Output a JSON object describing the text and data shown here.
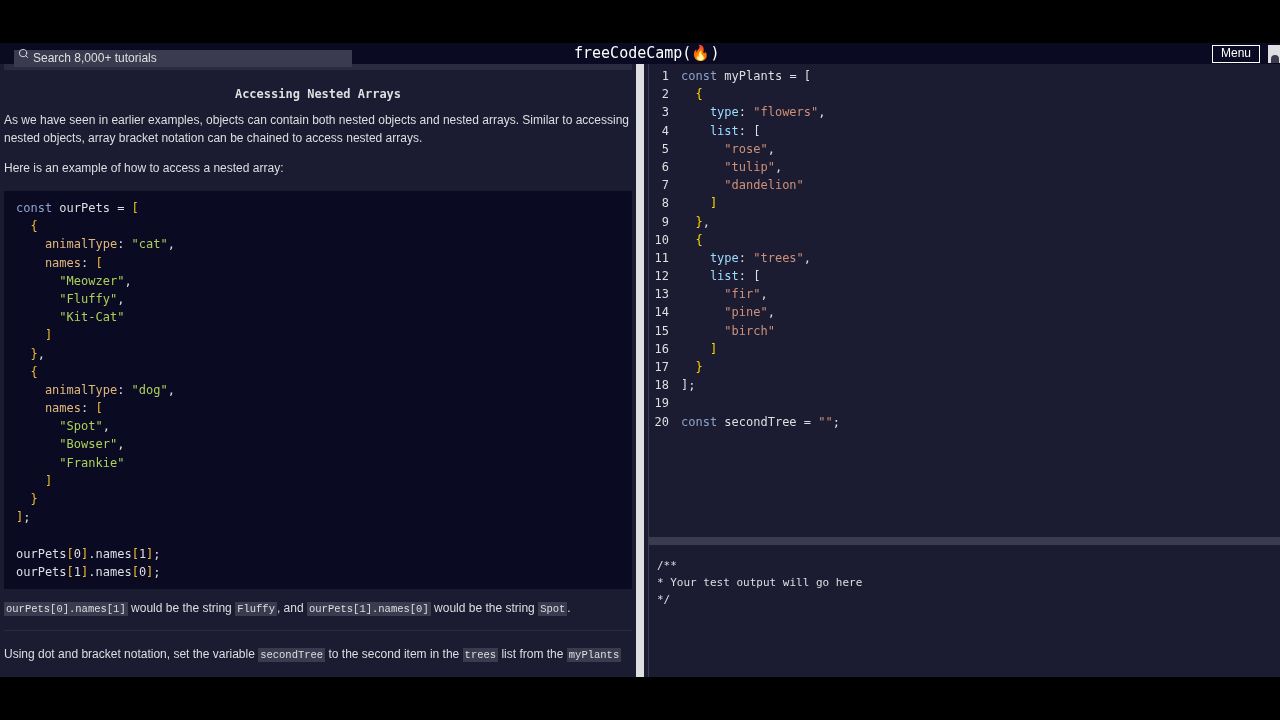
{
  "nav": {
    "search_placeholder": "Search 8,000+ tutorials",
    "logo": "freeCodeCamp(🔥)",
    "menu_button": "Menu"
  },
  "lesson": {
    "title": "Accessing Nested Arrays",
    "paragraphs": [
      [
        {
          "kind": "text",
          "t": "As we have seen in earlier examples, objects can contain both nested objects and nested arrays. Similar to accessing nested objects, array bracket notation can be chained to access nested arrays."
        }
      ],
      [
        {
          "kind": "text",
          "t": "Here is an example of how to access a nested array:"
        }
      ]
    ],
    "example_code": [
      {
        "kind": "code",
        "tokens": [
          {
            "kind": "kw",
            "t": "const"
          },
          {
            "kind": "id",
            "t": " ourPets "
          },
          {
            "kind": "op",
            "t": "= "
          },
          {
            "kind": "br",
            "t": "["
          }
        ]
      },
      {
        "kind": "code",
        "tokens": [
          {
            "kind": "br",
            "t": "  {"
          }
        ]
      },
      {
        "kind": "code",
        "tokens": [
          {
            "kind": "prop",
            "t": "    animalType"
          },
          {
            "kind": "op",
            "t": ": "
          },
          {
            "kind": "str",
            "t": "\"cat\""
          },
          {
            "kind": "op",
            "t": ","
          }
        ]
      },
      {
        "kind": "code",
        "tokens": [
          {
            "kind": "prop",
            "t": "    names"
          },
          {
            "kind": "op",
            "t": ": "
          },
          {
            "kind": "br",
            "t": "["
          }
        ]
      },
      {
        "kind": "code",
        "tokens": [
          {
            "kind": "str",
            "t": "      \"Meowzer\""
          },
          {
            "kind": "op",
            "t": ","
          }
        ]
      },
      {
        "kind": "code",
        "tokens": [
          {
            "kind": "str",
            "t": "      \"Fluffy\""
          },
          {
            "kind": "op",
            "t": ","
          }
        ]
      },
      {
        "kind": "code",
        "tokens": [
          {
            "kind": "str",
            "t": "      \"Kit-Cat\""
          }
        ]
      },
      {
        "kind": "code",
        "tokens": [
          {
            "kind": "br",
            "t": "    ]"
          }
        ]
      },
      {
        "kind": "code",
        "tokens": [
          {
            "kind": "br",
            "t": "  }"
          },
          {
            "kind": "op",
            "t": ","
          }
        ]
      },
      {
        "kind": "code",
        "tokens": [
          {
            "kind": "br",
            "t": "  {"
          }
        ]
      },
      {
        "kind": "code",
        "tokens": [
          {
            "kind": "prop",
            "t": "    animalType"
          },
          {
            "kind": "op",
            "t": ": "
          },
          {
            "kind": "str",
            "t": "\"dog\""
          },
          {
            "kind": "op",
            "t": ","
          }
        ]
      },
      {
        "kind": "code",
        "tokens": [
          {
            "kind": "prop",
            "t": "    names"
          },
          {
            "kind": "op",
            "t": ": "
          },
          {
            "kind": "br",
            "t": "["
          }
        ]
      },
      {
        "kind": "code",
        "tokens": [
          {
            "kind": "str",
            "t": "      \"Spot\""
          },
          {
            "kind": "op",
            "t": ","
          }
        ]
      },
      {
        "kind": "code",
        "tokens": [
          {
            "kind": "str",
            "t": "      \"Bowser\""
          },
          {
            "kind": "op",
            "t": ","
          }
        ]
      },
      {
        "kind": "code",
        "tokens": [
          {
            "kind": "str",
            "t": "      \"Frankie\""
          }
        ]
      },
      {
        "kind": "code",
        "tokens": [
          {
            "kind": "br",
            "t": "    ]"
          }
        ]
      },
      {
        "kind": "code",
        "tokens": [
          {
            "kind": "br",
            "t": "  }"
          }
        ]
      },
      {
        "kind": "code",
        "tokens": [
          {
            "kind": "br",
            "t": "]"
          },
          {
            "kind": "op",
            "t": ";"
          }
        ]
      },
      {
        "kind": "blank"
      },
      {
        "kind": "code",
        "tokens": [
          {
            "kind": "id",
            "t": "ourPets"
          },
          {
            "kind": "br",
            "t": "["
          },
          {
            "kind": "num",
            "t": "0"
          },
          {
            "kind": "br",
            "t": "]"
          },
          {
            "kind": "id",
            "t": ".names"
          },
          {
            "kind": "br",
            "t": "["
          },
          {
            "kind": "num",
            "t": "1"
          },
          {
            "kind": "br",
            "t": "]"
          },
          {
            "kind": "op",
            "t": ";"
          }
        ]
      },
      {
        "kind": "code",
        "tokens": [
          {
            "kind": "id",
            "t": "ourPets"
          },
          {
            "kind": "br",
            "t": "["
          },
          {
            "kind": "num",
            "t": "1"
          },
          {
            "kind": "br",
            "t": "]"
          },
          {
            "kind": "id",
            "t": ".names"
          },
          {
            "kind": "br",
            "t": "["
          },
          {
            "kind": "num",
            "t": "0"
          },
          {
            "kind": "br",
            "t": "]"
          },
          {
            "kind": "op",
            "t": ";"
          }
        ]
      }
    ],
    "after_paragraphs": [
      [
        {
          "kind": "code",
          "t": "ourPets[0].names[1]"
        },
        {
          "kind": "text",
          "t": " would be the string "
        },
        {
          "kind": "code",
          "t": "Fluffy"
        },
        {
          "kind": "text",
          "t": ", and "
        },
        {
          "kind": "code",
          "t": "ourPets[1].names[0]"
        },
        {
          "kind": "text",
          "t": " would be the string "
        },
        {
          "kind": "code",
          "t": "Spot"
        },
        {
          "kind": "text",
          "t": "."
        }
      ],
      [
        {
          "kind": "text",
          "t": "Using dot and bracket notation, set the variable "
        },
        {
          "kind": "code",
          "t": "secondTree"
        },
        {
          "kind": "text",
          "t": " to the second item in the "
        },
        {
          "kind": "code",
          "t": "trees"
        },
        {
          "kind": "text",
          "t": " list from the "
        },
        {
          "kind": "code",
          "t": "myPlants"
        }
      ]
    ]
  },
  "editor": {
    "lines": [
      {
        "kind": "code",
        "tokens": [
          {
            "kind": "kw",
            "t": "const"
          },
          {
            "kind": "id",
            "t": " myPlants "
          },
          {
            "kind": "op",
            "t": "= "
          },
          {
            "kind": "op",
            "t": "["
          }
        ]
      },
      {
        "kind": "code",
        "tokens": [
          {
            "kind": "br",
            "t": "  {"
          }
        ]
      },
      {
        "kind": "code",
        "tokens": [
          {
            "kind": "prop",
            "t": "    type"
          },
          {
            "kind": "op",
            "t": ": "
          },
          {
            "kind": "str",
            "t": "\"flowers\""
          },
          {
            "kind": "op",
            "t": ","
          }
        ]
      },
      {
        "kind": "code",
        "tokens": [
          {
            "kind": "prop",
            "t": "    list"
          },
          {
            "kind": "op",
            "t": ": "
          },
          {
            "kind": "op",
            "t": "["
          }
        ]
      },
      {
        "kind": "code",
        "tokens": [
          {
            "kind": "str",
            "t": "      \"rose\""
          },
          {
            "kind": "op",
            "t": ","
          }
        ]
      },
      {
        "kind": "code",
        "tokens": [
          {
            "kind": "str",
            "t": "      \"tulip\""
          },
          {
            "kind": "op",
            "t": ","
          }
        ]
      },
      {
        "kind": "code",
        "tokens": [
          {
            "kind": "str",
            "t": "      \"dandelion\""
          }
        ]
      },
      {
        "kind": "code",
        "tokens": [
          {
            "kind": "br",
            "t": "    ]"
          }
        ]
      },
      {
        "kind": "code",
        "tokens": [
          {
            "kind": "br",
            "t": "  }"
          },
          {
            "kind": "op",
            "t": ","
          }
        ]
      },
      {
        "kind": "code",
        "tokens": [
          {
            "kind": "br",
            "t": "  {"
          }
        ]
      },
      {
        "kind": "code",
        "tokens": [
          {
            "kind": "prop",
            "t": "    type"
          },
          {
            "kind": "op",
            "t": ": "
          },
          {
            "kind": "str",
            "t": "\"trees\""
          },
          {
            "kind": "op",
            "t": ","
          }
        ]
      },
      {
        "kind": "code",
        "tokens": [
          {
            "kind": "prop",
            "t": "    list"
          },
          {
            "kind": "op",
            "t": ": "
          },
          {
            "kind": "op",
            "t": "["
          }
        ]
      },
      {
        "kind": "code",
        "tokens": [
          {
            "kind": "str",
            "t": "      \"fir\""
          },
          {
            "kind": "op",
            "t": ","
          }
        ]
      },
      {
        "kind": "code",
        "tokens": [
          {
            "kind": "str",
            "t": "      \"pine\""
          },
          {
            "kind": "op",
            "t": ","
          }
        ]
      },
      {
        "kind": "code",
        "tokens": [
          {
            "kind": "str",
            "t": "      \"birch\""
          }
        ]
      },
      {
        "kind": "code",
        "tokens": [
          {
            "kind": "br",
            "t": "    ]"
          }
        ]
      },
      {
        "kind": "code",
        "tokens": [
          {
            "kind": "br",
            "t": "  }"
          }
        ]
      },
      {
        "kind": "code",
        "tokens": [
          {
            "kind": "op",
            "t": "];"
          }
        ]
      },
      {
        "kind": "blank"
      },
      {
        "kind": "code",
        "tokens": [
          {
            "kind": "kw",
            "t": "const"
          },
          {
            "kind": "id",
            "t": " secondTree "
          },
          {
            "kind": "op",
            "t": "= "
          },
          {
            "kind": "str",
            "t": "\"\""
          },
          {
            "kind": "op",
            "t": ";"
          }
        ]
      }
    ],
    "line_numbers": [
      "1",
      "2",
      "3",
      "4",
      "5",
      "6",
      "7",
      "8",
      "9",
      "10",
      "11",
      "12",
      "13",
      "14",
      "15",
      "16",
      "17",
      "18",
      "19",
      "20"
    ]
  },
  "output": {
    "lines": [
      "/**",
      "* Your test output will go here",
      "*/"
    ]
  }
}
